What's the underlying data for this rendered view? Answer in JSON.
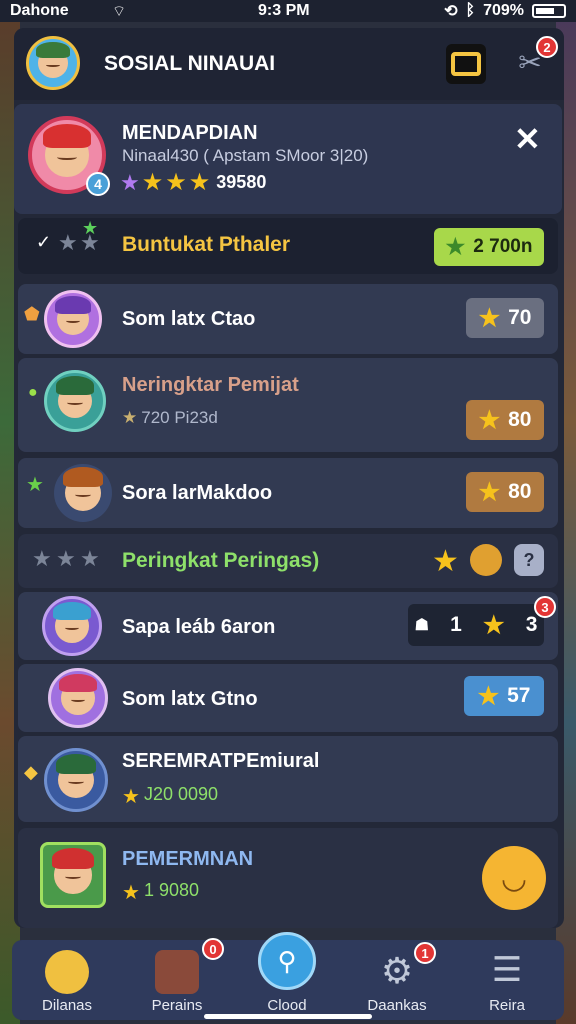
{
  "status": {
    "carrier": "Dahone",
    "time": "9:3 PM",
    "battery": "709%"
  },
  "header": {
    "title": "SOSIAL NINAUAI"
  },
  "profile": {
    "name": "MENDAPDIAN",
    "subtitle": "Ninaal430 ( Apstam SMoor 3|20)",
    "score": "39580",
    "badge": "4"
  },
  "sections": [
    {
      "title": "Buntukat Pthaler",
      "badge_value": "2 700n",
      "color": "#f5c542"
    },
    {
      "title": "Peringkat Peringas)",
      "color": "#8ee06a"
    }
  ],
  "list1": [
    {
      "name": "Som latx Ctao",
      "value": "70"
    },
    {
      "name": "Neringktar Pemijat",
      "sub": "720 Pi23d",
      "value": "80"
    },
    {
      "name": "Sora larMakdoo",
      "value": "80"
    }
  ],
  "list2": [
    {
      "name": "Sapa leáb 6aron",
      "left_value": "1",
      "right_value": "3",
      "bubble": "3"
    },
    {
      "name": "Som latx Gtno",
      "value": "57"
    },
    {
      "name": "SEREMRATPEmiural",
      "sub": "J20 0090"
    },
    {
      "name": "PEMERMNAN",
      "sub": "1 9080",
      "color": "#8fb8f0"
    }
  ],
  "tabs": [
    {
      "label": "Dilanas",
      "icon": "hero-icon"
    },
    {
      "label": "Perains",
      "icon": "character-icon",
      "bubble": "0"
    },
    {
      "label": "Clood",
      "icon": "search-icon"
    },
    {
      "label": "Daankas",
      "icon": "gear-icon",
      "bubble": "1"
    },
    {
      "label": "Reira",
      "icon": "menu-icon"
    }
  ],
  "header_bubble": "2",
  "colors": {
    "accent_green": "#8ee06a",
    "gold": "#f5c542",
    "blue_badge": "#4aa0d8"
  }
}
